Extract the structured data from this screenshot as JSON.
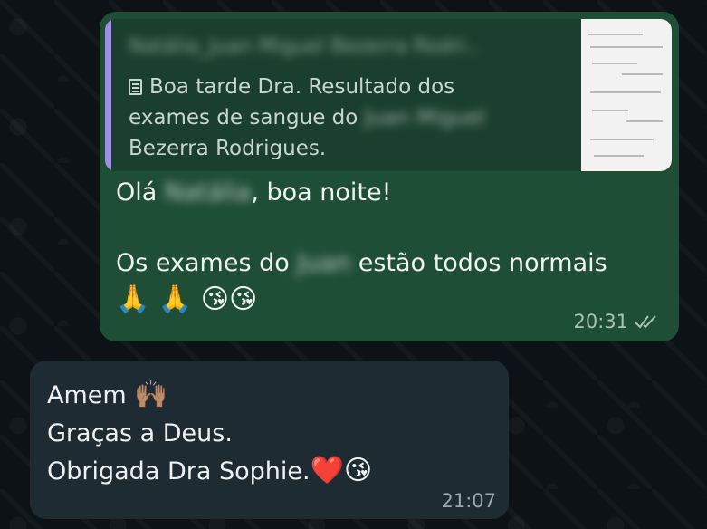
{
  "outgoing_message": {
    "quote": {
      "author": "Natália_Juan Miguel Bezerra Rodri..",
      "doc_label": "Boa tarde  Dra.  Resultado dos exames de sangue do",
      "doc_name_blurred": "Juan Miguel",
      "doc_label_end": "Bezerra Rodrigues."
    },
    "greeting_prefix": "Olá",
    "greeting_name_blurred": "Natália",
    "greeting_suffix": ", boa noite!",
    "line2_prefix": "Os exames do",
    "line2_name_blurred": "Juan",
    "line2_suffix": "estão todos normais",
    "emojis": "🙏 🙏 😘😘",
    "time": "20:31",
    "status_icon": "double-check-icon"
  },
  "incoming_message": {
    "line1": "Amem",
    "line1_emoji": "🙌🏽",
    "line2": "Graças a Deus.",
    "line3": "Obrigada Dra Sophie.",
    "line3_emojis": "❤️😘",
    "time": "21:07"
  }
}
